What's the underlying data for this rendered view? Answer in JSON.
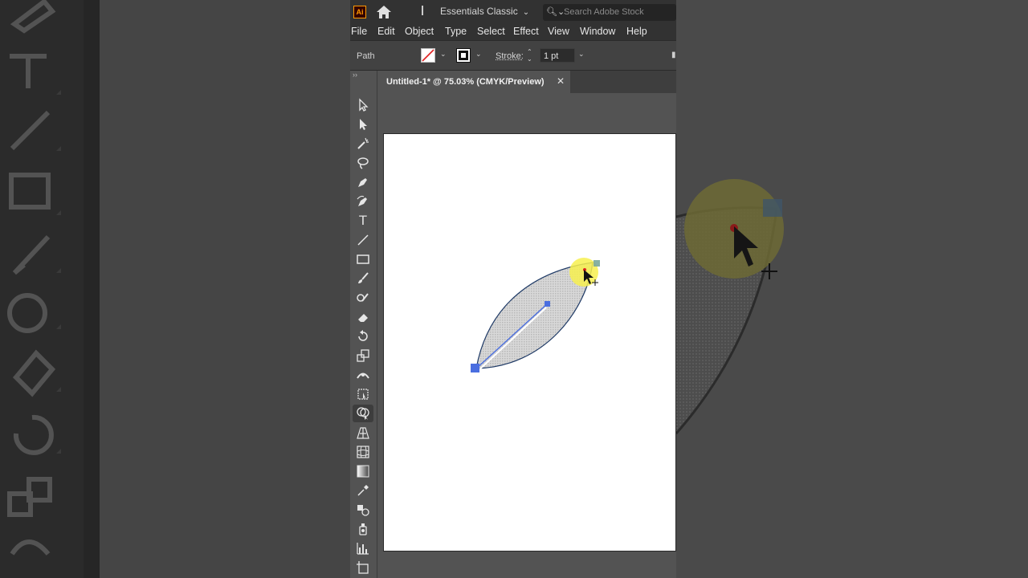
{
  "titlebar": {
    "app_logo": "Ai",
    "workspace": "Essentials Classic",
    "search_placeholder": "Search Adobe Stock"
  },
  "menu": [
    "File",
    "Edit",
    "Object",
    "Type",
    "Select",
    "Effect",
    "View",
    "Window",
    "Help"
  ],
  "control_bar": {
    "selection_type": "Path",
    "stroke_label": "Stroke:",
    "stroke_value": "1 pt"
  },
  "document_tab": {
    "title": "Untitled-1* @ 75.03% (CMYK/Preview)"
  },
  "tools": [
    "selection-tool",
    "direct-selection-tool",
    "magic-wand-tool",
    "lasso-tool",
    "pen-tool",
    "curvature-tool",
    "type-tool",
    "line-segment-tool",
    "rectangle-tool",
    "paintbrush-tool",
    "shaper-tool",
    "eraser-tool",
    "rotate-tool",
    "scale-tool",
    "width-tool",
    "free-transform-tool",
    "shape-builder-tool",
    "perspective-grid-tool",
    "mesh-tool",
    "gradient-tool",
    "eyedropper-tool",
    "blend-tool",
    "symbol-sprayer-tool",
    "column-graph-tool",
    "artboard-tool"
  ],
  "active_tool": "shape-builder-tool",
  "colors": {
    "app_bg": "#535353",
    "bar_bg": "#323232",
    "selection_blue": "#4a6ee0",
    "highlight_yellow": "#f7f04f",
    "anchor_red": "#e02020"
  }
}
